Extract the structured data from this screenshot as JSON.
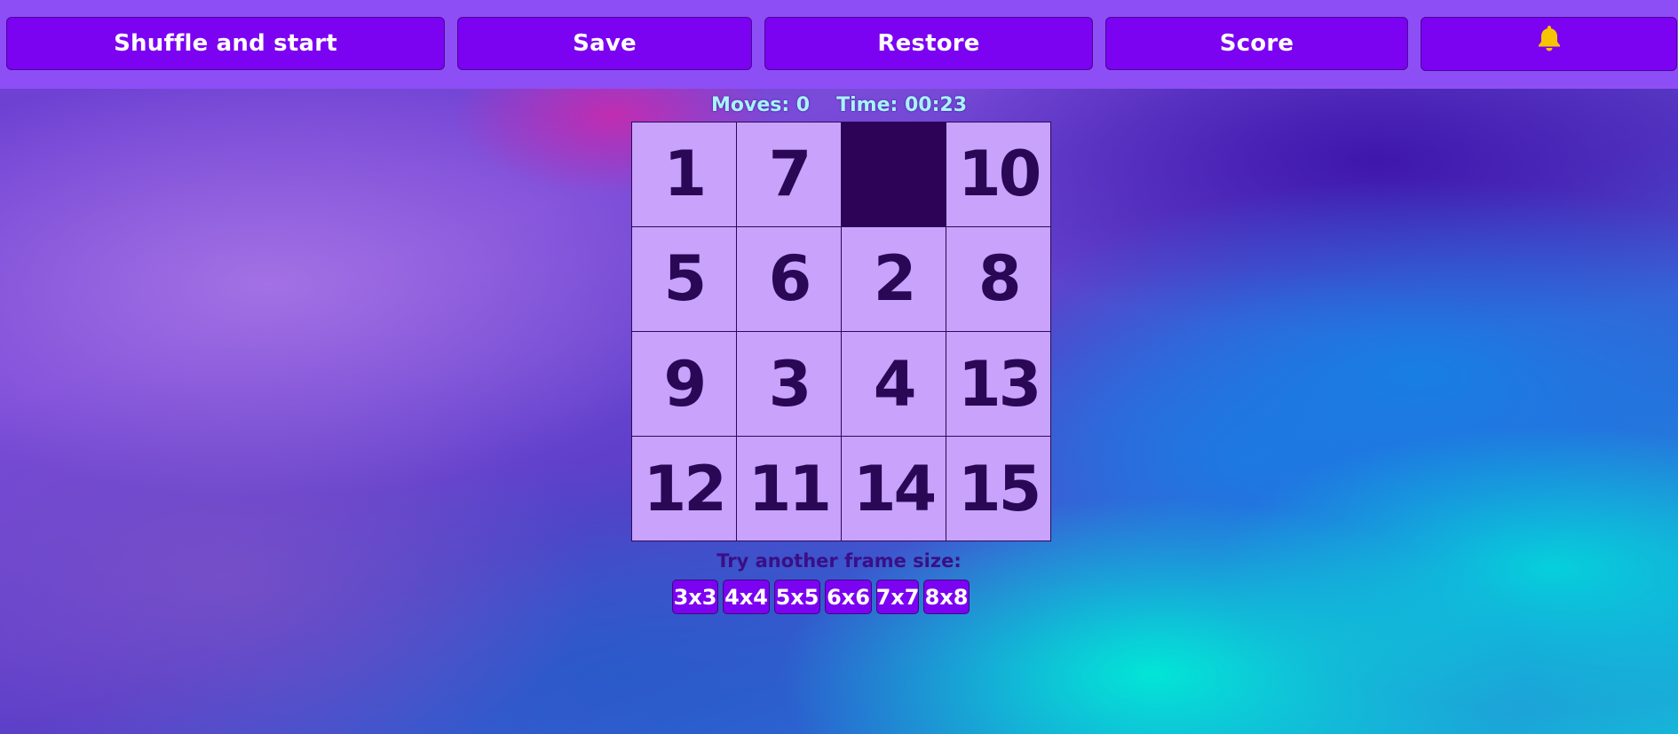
{
  "toolbar": {
    "shuffle_label": "Shuffle and start",
    "save_label": "Save",
    "restore_label": "Restore",
    "score_label": "Score",
    "bell_icon": "bell-icon",
    "bell_color": "#f6c400"
  },
  "status": {
    "moves": "Moves: 0",
    "time": "Time: 00:23"
  },
  "board": {
    "size": "4x4",
    "tiles": [
      "1",
      "7",
      "",
      "10",
      "5",
      "6",
      "2",
      "8",
      "9",
      "3",
      "4",
      "13",
      "12",
      "11",
      "14",
      "15"
    ]
  },
  "frame_sizes": {
    "prompt": "Try another frame size:",
    "options": [
      "3x3",
      "4x4",
      "5x5",
      "6x6",
      "7x7",
      "8x8"
    ]
  },
  "colors": {
    "toolbar_bg": "#8d4ff5",
    "button_bg": "#7c02f2",
    "tile_bg": "#c8a2fb",
    "tile_text": "#2a0856",
    "empty_tile": "#2d0358",
    "status_text": "#a8f3ff"
  }
}
